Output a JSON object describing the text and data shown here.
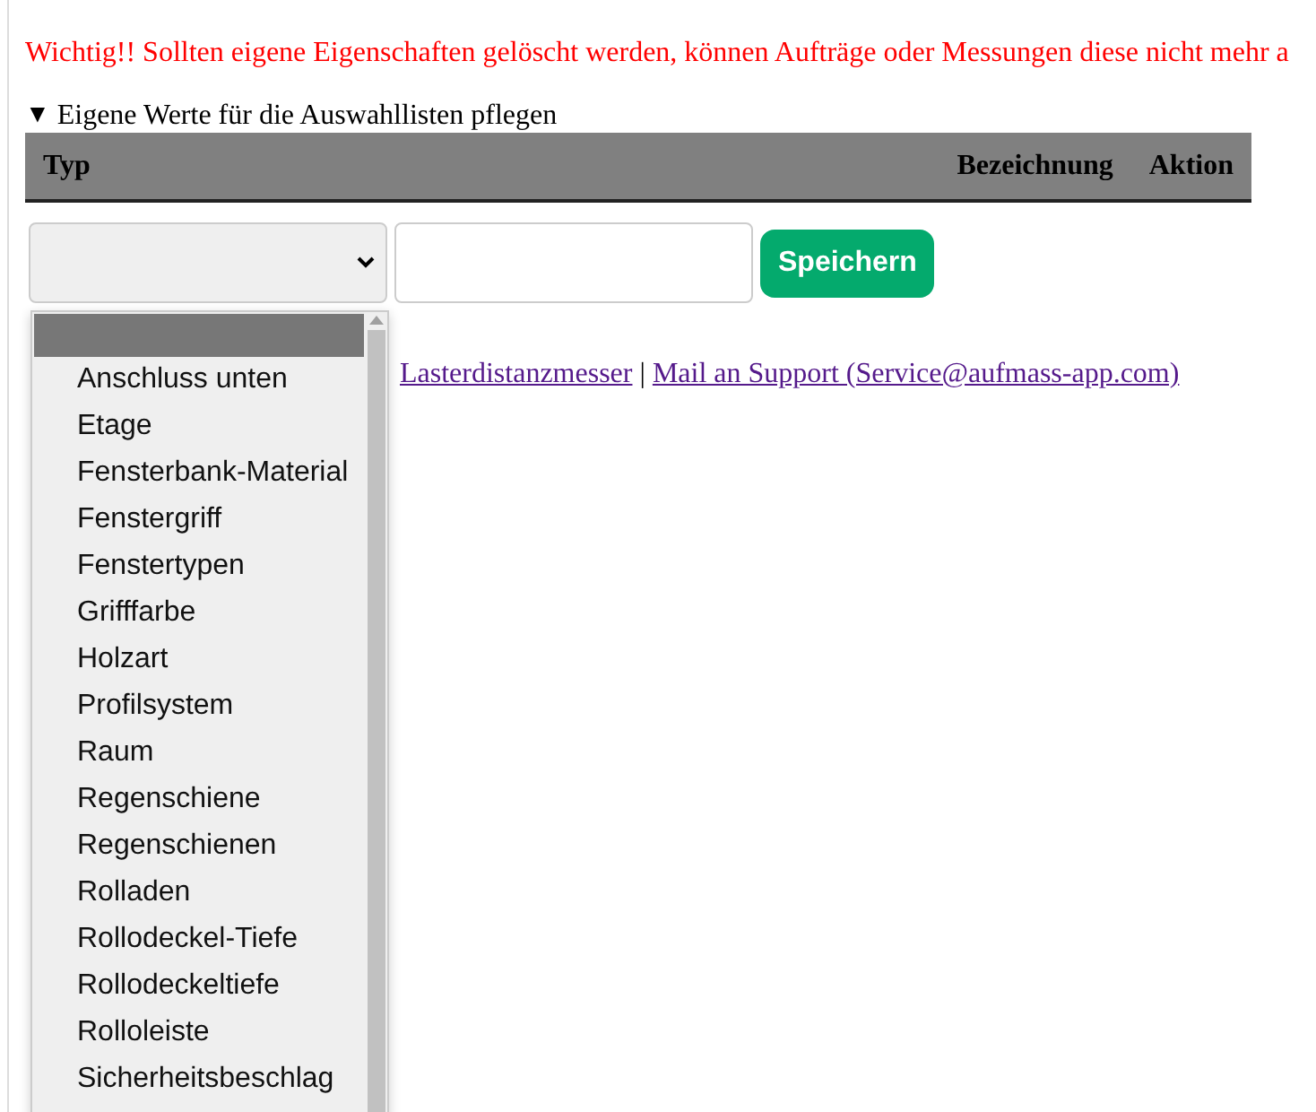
{
  "warning": "Wichtig!! Sollten eigene Eigenschaften gelöscht werden, können Aufträge oder Messungen diese nicht mehr a",
  "section": {
    "title": "Eigene Werte für die Auswahllisten pflegen",
    "expanded": true,
    "marker": "▼"
  },
  "table": {
    "columns": [
      "Typ",
      "Bezeichnung",
      "Aktion"
    ]
  },
  "form": {
    "save_button": "Speichern"
  },
  "dropdown": {
    "items": [
      {
        "selected": true
      },
      {
        "label": "Anschluss unten",
        "selected": false
      },
      {
        "label": "Etage",
        "selected": false
      },
      {
        "label": "Fensterbank-Material",
        "selected": false
      },
      {
        "label": "Fenstergriff",
        "selected": false
      },
      {
        "label": "Fenstertypen",
        "selected": false
      },
      {
        "label": "Grifffarbe",
        "selected": false
      },
      {
        "label": "Holzart",
        "selected": false
      },
      {
        "label": "Profilsystem",
        "selected": false
      },
      {
        "label": "Raum",
        "selected": false
      },
      {
        "label": "Regenschiene",
        "selected": false
      },
      {
        "label": "Regenschienen",
        "selected": false
      },
      {
        "label": "Rolladen",
        "selected": false
      },
      {
        "label": "Rollodeckel-Tiefe",
        "selected": false
      },
      {
        "label": "Rollodeckeltiefe",
        "selected": false
      },
      {
        "label": "Rolloleiste",
        "selected": false
      },
      {
        "label": "Sicherheitsbeschlag",
        "selected": false
      }
    ]
  },
  "footer": {
    "links": [
      "Lasterdistanzmesser",
      "Mail an Support (Service@aufmass-app.com)"
    ],
    "separator": "|"
  }
}
